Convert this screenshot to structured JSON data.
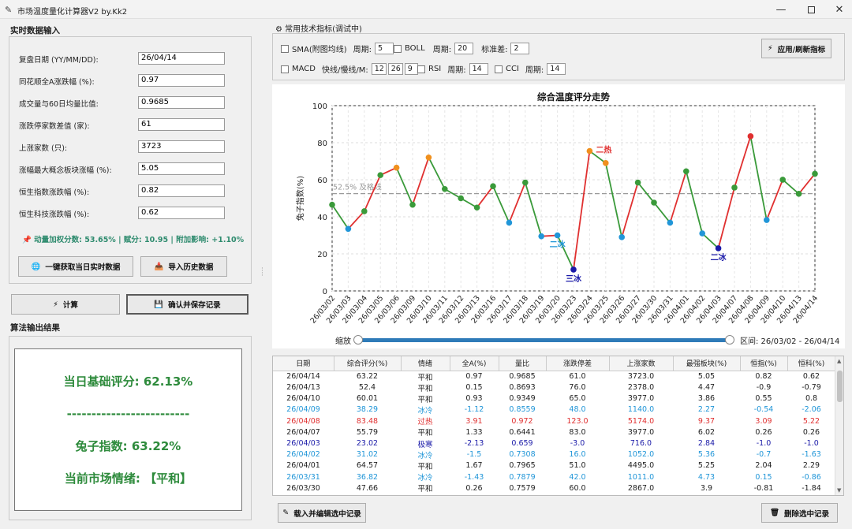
{
  "window": {
    "title": "市场温度量化计算器V2 by.Kk2",
    "icon": "feather-icon"
  },
  "input_section": {
    "title": "实时数据输入",
    "fields": [
      {
        "label": "复盘日期 (YY/MM/DD):",
        "value": "26/04/14"
      },
      {
        "label": "同花顺全A涨跌幅 (%):",
        "value": "0.97"
      },
      {
        "label": "成交量与60日均量比值:",
        "value": "0.9685"
      },
      {
        "label": "涨跌停家数差值 (家):",
        "value": "61"
      },
      {
        "label": "上涨家数 (只):",
        "value": "3723"
      },
      {
        "label": "涨幅最大概念板块涨幅 (%):",
        "value": "5.05"
      },
      {
        "label": "恒生指数涨跌幅 (%):",
        "value": "0.82"
      },
      {
        "label": "恒生科技涨跌幅 (%):",
        "value": "0.62"
      }
    ],
    "status": "动量加权分数: 53.65% | 赋分: 10.95 | 附加影响: +1.10%",
    "fetch_button": "一键获取当日实时数据",
    "import_button": "导入历史数据"
  },
  "actions": {
    "calc_button": "计算",
    "save_button": "确认并保存记录"
  },
  "output_section": {
    "title": "算法输出结果",
    "base_score": "当日基础评分: 62.13%",
    "divider": "-------------------------",
    "rabbit_index": "兔子指数: 63.22%",
    "sentiment": "当前市场情绪: 【平和】"
  },
  "indicators": {
    "title": "常用技术指标(调试中)",
    "sma": {
      "label": "SMA(附图均线)",
      "period_label": "周期:",
      "period": "5"
    },
    "boll": {
      "label": "BOLL",
      "period_label": "周期:",
      "period": "20",
      "std_label": "标准差:",
      "std": "2"
    },
    "macd": {
      "label": "MACD",
      "lines_label": "快线/慢线/M:",
      "fast": "12",
      "slow": "26",
      "m": "9"
    },
    "rsi": {
      "label": "RSI",
      "period_label": "周期:",
      "period": "14"
    },
    "cci": {
      "label": "CCI",
      "period_label": "周期:",
      "period": "14"
    },
    "apply_button": "应用/刷新指标"
  },
  "chart_data": {
    "type": "line",
    "title": "综合温度评分走势",
    "ylabel": "兔子指数(%)",
    "xlabel": "",
    "ylim": [
      0,
      100
    ],
    "yticks": [
      0,
      20,
      40,
      60,
      80,
      100
    ],
    "grid": true,
    "x": [
      "26/03/02",
      "26/03/03",
      "26/03/04",
      "26/03/05",
      "26/03/06",
      "26/03/09",
      "26/03/10",
      "26/03/11",
      "26/03/12",
      "26/03/13",
      "26/03/16",
      "26/03/17",
      "26/03/18",
      "26/03/19",
      "26/03/20",
      "26/03/23",
      "26/03/24",
      "26/03/25",
      "26/03/26",
      "26/03/27",
      "26/03/30",
      "26/03/31",
      "26/04/01",
      "26/04/02",
      "26/04/03",
      "26/04/07",
      "26/04/08",
      "26/04/09",
      "26/04/10",
      "26/04/13",
      "26/04/14"
    ],
    "values": [
      46.5,
      33.5,
      43,
      62.5,
      66.5,
      46.5,
      72,
      55,
      50,
      45,
      56.5,
      36.82,
      58.5,
      29.5,
      30,
      11.5,
      75.5,
      69,
      29,
      58.5,
      47.66,
      36.82,
      64.57,
      31.02,
      23.02,
      55.79,
      83.48,
      38.29,
      60.01,
      52.4,
      63.22
    ],
    "reference_line": {
      "value": 52.5,
      "label": "52.5% 及格线"
    },
    "point_colors": [
      "#3a9a3a",
      "#2196d8",
      "#3a9a3a",
      "#3a9a3a",
      "#f0901e",
      "#3a9a3a",
      "#f0901e",
      "#3a9a3a",
      "#3a9a3a",
      "#3a9a3a",
      "#3a9a3a",
      "#2196d8",
      "#3a9a3a",
      "#2196d8",
      "#2196d8",
      "#1a1aa8",
      "#f0901e",
      "#f0901e",
      "#2196d8",
      "#3a9a3a",
      "#3a9a3a",
      "#2196d8",
      "#3a9a3a",
      "#2196d8",
      "#1a1aa8",
      "#3a9a3a",
      "#e03030",
      "#2196d8",
      "#3a9a3a",
      "#3a9a3a",
      "#3a9a3a"
    ],
    "annotations": [
      {
        "index": 14,
        "text": "二冰",
        "color": "#2196d8"
      },
      {
        "index": 15,
        "text": "三冰",
        "color": "#1a1aa8"
      },
      {
        "index": 16,
        "text": "二热",
        "color": "#e03030"
      },
      {
        "index": 24,
        "text": "二冰",
        "color": "#1a1aa8"
      }
    ],
    "up_color": "#e03030",
    "down_color": "#3a9a3a"
  },
  "zoom": {
    "label": "缩放",
    "range_text": "区间: 26/03/02 - 26/04/14"
  },
  "table": {
    "headers": [
      "日期",
      "综合评分(%)",
      "情绪",
      "全A(%)",
      "量比",
      "涨跌停差",
      "上涨家数",
      "最强板块(%)",
      "恒指(%)",
      "恒科(%)"
    ],
    "rows": [
      {
        "cells": [
          "26/04/14",
          "63.22",
          "平和",
          "0.97",
          "0.9685",
          "61.0",
          "3723.0",
          "5.05",
          "0.82",
          "0.62"
        ],
        "color": "#222222"
      },
      {
        "cells": [
          "26/04/13",
          "52.4",
          "平和",
          "0.15",
          "0.8693",
          "76.0",
          "2378.0",
          "4.47",
          "-0.9",
          "-0.79"
        ],
        "color": "#222222"
      },
      {
        "cells": [
          "26/04/10",
          "60.01",
          "平和",
          "0.93",
          "0.9349",
          "65.0",
          "3977.0",
          "3.86",
          "0.55",
          "0.8"
        ],
        "color": "#222222"
      },
      {
        "cells": [
          "26/04/09",
          "38.29",
          "冰冷",
          "-1.12",
          "0.8559",
          "48.0",
          "1140.0",
          "2.27",
          "-0.54",
          "-2.06"
        ],
        "color": "#2196d8"
      },
      {
        "cells": [
          "26/04/08",
          "83.48",
          "过热",
          "3.91",
          "0.972",
          "123.0",
          "5174.0",
          "9.37",
          "3.09",
          "5.22"
        ],
        "color": "#e03030"
      },
      {
        "cells": [
          "26/04/07",
          "55.79",
          "平和",
          "1.33",
          "0.6441",
          "83.0",
          "3977.0",
          "6.02",
          "0.26",
          "0.26"
        ],
        "color": "#222222"
      },
      {
        "cells": [
          "26/04/03",
          "23.02",
          "极寒",
          "-2.13",
          "0.659",
          "-3.0",
          "716.0",
          "2.84",
          "-1.0",
          "-1.0"
        ],
        "color": "#1a1aa8"
      },
      {
        "cells": [
          "26/04/02",
          "31.02",
          "冰冷",
          "-1.5",
          "0.7308",
          "16.0",
          "1052.0",
          "5.36",
          "-0.7",
          "-1.63"
        ],
        "color": "#2196d8"
      },
      {
        "cells": [
          "26/04/01",
          "64.57",
          "平和",
          "1.67",
          "0.7965",
          "51.0",
          "4495.0",
          "5.25",
          "2.04",
          "2.29"
        ],
        "color": "#222222"
      },
      {
        "cells": [
          "26/03/31",
          "36.82",
          "冰冷",
          "-1.43",
          "0.7879",
          "42.0",
          "1011.0",
          "4.73",
          "0.15",
          "-0.86"
        ],
        "color": "#2196d8"
      },
      {
        "cells": [
          "26/03/30",
          "47.66",
          "平和",
          "0.26",
          "0.7579",
          "60.0",
          "2867.0",
          "3.9",
          "-0.81",
          "-1.84"
        ],
        "color": "#222222"
      }
    ]
  },
  "bottom_buttons": {
    "load_edit": "载入并编辑选中记录",
    "delete": "删除选中记录"
  }
}
